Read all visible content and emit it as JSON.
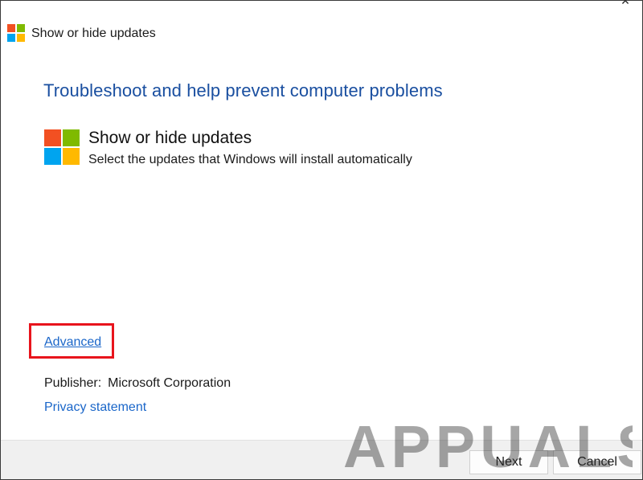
{
  "window": {
    "title": "Show or hide updates",
    "close_glyph": "×",
    "logo_icon": "windows-logo-icon"
  },
  "main": {
    "heading": "Troubleshoot and help prevent computer problems",
    "task_title": "Show or hide updates",
    "task_description": "Select the updates that Windows will install automatically",
    "advanced_link": "Advanced",
    "publisher_label": "Publisher:",
    "publisher_value": "Microsoft Corporation",
    "privacy_link": "Privacy statement"
  },
  "footer": {
    "next_label": "Next",
    "cancel_label": "Cancel"
  },
  "watermark": {
    "text": "APPUALS"
  },
  "colors": {
    "heading": "#1a4fa0",
    "link": "#1a66c9",
    "highlight_frame": "#e8141c",
    "ms_red": "#f25022",
    "ms_green": "#7fba00",
    "ms_blue": "#00a4ef",
    "ms_yellow": "#ffb900"
  }
}
